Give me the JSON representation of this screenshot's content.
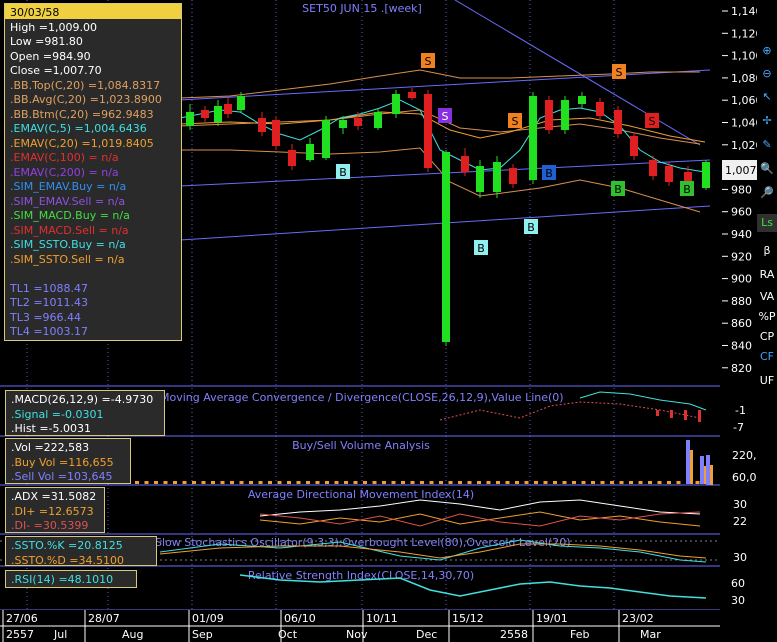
{
  "chart": {
    "title": "SET50 JUN 15 .[week]"
  },
  "info_box": {
    "date": "30/03/58",
    "rows": [
      {
        "text": "High  =1,009.00",
        "color": "#ffffff"
      },
      {
        "text": "Low  =981.80",
        "color": "#ffffff"
      },
      {
        "text": "Open  =984.90",
        "color": "#ffffff"
      },
      {
        "text": "Close  =1,007.70",
        "color": "#ffffff"
      },
      {
        "text": ".BB.Top(C,20)  =1,084.8317",
        "color": "#e0a060"
      },
      {
        "text": ".BB.Avg(C,20)  =1,023.8900",
        "color": "#e0a060"
      },
      {
        "text": ".BB.Btm(C,20)  =962.9483",
        "color": "#e0a060"
      },
      {
        "text": ".EMAV(C,5)  =1,004.6436",
        "color": "#40e0e0"
      },
      {
        "text": ".EMAV(C,20)  =1,019.8405",
        "color": "#f0a030"
      },
      {
        "text": ".EMAV(C,100)  = n/a",
        "color": "#e03030"
      },
      {
        "text": ".EMAV(C,200)  = n/a",
        "color": "#9040e0"
      },
      {
        "text": ".SIM_EMAV.Buy  = n/a",
        "color": "#3090f0"
      },
      {
        "text": ".SIM_EMAV.Sell  = n/a",
        "color": "#9050e0"
      },
      {
        "text": ".SIM_MACD.Buy  = n/a",
        "color": "#40e040"
      },
      {
        "text": ".SIM_MACD.Sell  = n/a",
        "color": "#e03030"
      },
      {
        "text": ".SIM_SSTO.Buy  = n/a",
        "color": "#40e0e0"
      },
      {
        "text": ".SIM_SSTO.Sell  = n/a",
        "color": "#f0a030"
      },
      {
        "text": "",
        "color": "#ffffff"
      },
      {
        "text": "TL1 =1088.47",
        "color": "#8080ff"
      },
      {
        "text": "TL2 =1011.43",
        "color": "#8080ff"
      },
      {
        "text": "TL3 =966.44",
        "color": "#8080ff"
      },
      {
        "text": "TL4 =1003.17",
        "color": "#8080ff"
      }
    ]
  },
  "price_axis": {
    "ticks": [
      "1,140",
      "1,120",
      "1,100",
      "1,080",
      "1,060",
      "1,040",
      "1,020",
      "1,000",
      "980",
      "960",
      "940",
      "920",
      "900",
      "880",
      "860",
      "840",
      "820"
    ],
    "current": "1,007."
  },
  "signals": [
    "S",
    "S",
    "S",
    "S",
    "S",
    "B",
    "B",
    "B",
    "B",
    "B",
    "B"
  ],
  "macd": {
    "title": "Moving Average Convergence / Divergence(CLOSE,26,12,9),Value Line(0)",
    "box": [
      {
        "text": ".MACD(26,12,9)  =-4.9730",
        "color": "#ffffff"
      },
      {
        "text": ".Signal  =-0.0301",
        "color": "#40e0e0"
      },
      {
        "text": ".Hist  =-5.0031",
        "color": "#ffffff"
      }
    ],
    "ticks": [
      "-1",
      "-7"
    ]
  },
  "volume": {
    "title": "Buy/Sell Volume Analysis",
    "box": [
      {
        "text": ".Vol  =222,583",
        "color": "#ffffff"
      },
      {
        "text": ".Buy Vol  =116,655",
        "color": "#f0a030"
      },
      {
        "text": ".Sell Vol  =103,645",
        "color": "#8080ff"
      }
    ],
    "ticks": [
      "220,0",
      "60,00"
    ]
  },
  "adx": {
    "title": "Average Directional Movement Index(14)",
    "box": [
      {
        "text": ".ADX  =31.5082",
        "color": "#ffffff"
      },
      {
        "text": ".DI+  =12.6573",
        "color": "#f0a030"
      },
      {
        "text": ".DI-  =30.5399",
        "color": "#e05050"
      }
    ],
    "ticks": [
      "30",
      "22"
    ]
  },
  "ssto": {
    "title": "Slow Stochastics Oscillator(9,3,3),Overbought Level(80),Oversold Level(20)",
    "box": [
      {
        "text": ".SSTO.%K  =20.8125",
        "color": "#40e0e0"
      },
      {
        "text": ".SSTO.%D  =34.5100",
        "color": "#f0a030"
      }
    ],
    "ticks": [
      "30"
    ]
  },
  "rsi": {
    "title": "Relative Strength Index(CLOSE,14,30,70)",
    "box": [
      {
        "text": ".RSI(14)  =48.1010",
        "color": "#40e0e0"
      }
    ],
    "ticks": [
      "60",
      "30"
    ]
  },
  "x_axis": {
    "dates": [
      "27/06",
      "28/07",
      "01/09",
      "06/10",
      "10/11",
      "15/12",
      "19/01",
      "23/02"
    ],
    "months": [
      "2557",
      "Jul",
      "Aug",
      "Sep",
      "Oct",
      "Nov",
      "Dec",
      "2558",
      "Feb",
      "Mar"
    ]
  },
  "toolbar": {
    "items": [
      {
        "icon": "zoom-in-icon",
        "label": ""
      },
      {
        "icon": "zoom-out-icon",
        "label": ""
      },
      {
        "icon": "cursor-icon",
        "label": ""
      },
      {
        "icon": "crosshair-icon",
        "label": ""
      },
      {
        "icon": "eraser-icon",
        "label": ""
      },
      {
        "icon": "magnify-plus-icon",
        "label": ""
      },
      {
        "icon": "magnify-minus-icon",
        "label": ""
      },
      {
        "icon": "ls-icon",
        "label": "Ls"
      },
      {
        "icon": "beta-icon",
        "label": "β"
      },
      {
        "icon": "ra-icon",
        "label": "RA"
      },
      {
        "icon": "va-icon",
        "label": "VA"
      },
      {
        "icon": "percent-p-icon",
        "label": "%P"
      },
      {
        "icon": "cp-icon",
        "label": "CP"
      },
      {
        "icon": "cf-icon",
        "label": "CF"
      },
      {
        "icon": "uf-icon",
        "label": "UF"
      }
    ]
  }
}
